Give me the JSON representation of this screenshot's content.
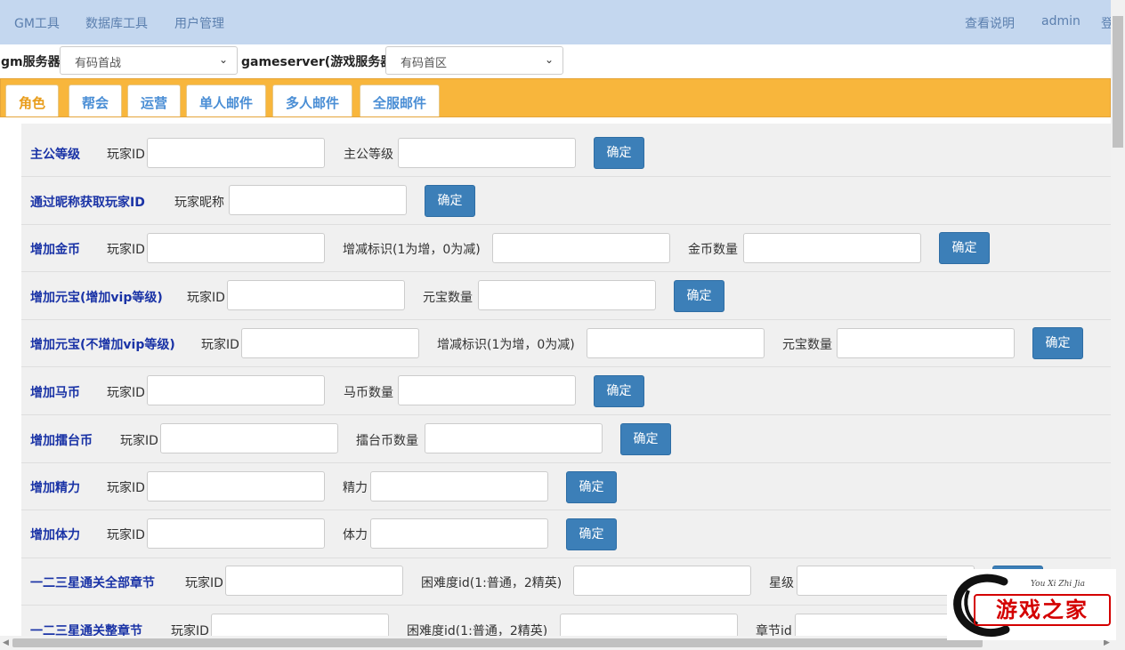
{
  "topnav": {
    "items": [
      "GM工具",
      "数据库工具",
      "用户管理"
    ],
    "right": [
      "查看说明",
      "admin",
      "登"
    ]
  },
  "servers": {
    "gm_label": "gm服务器",
    "gm_value": "有码首战",
    "game_label": "gameserver(游戏服务器)",
    "game_value": "有码首区"
  },
  "tabs": [
    "角色",
    "帮会",
    "运营",
    "单人邮件",
    "多人邮件",
    "全服邮件"
  ],
  "active_tab": "角色",
  "confirm_label": "确定",
  "rows": [
    {
      "title": "主公等级",
      "fields": [
        "玩家ID",
        "主公等级"
      ]
    },
    {
      "title": "通过昵称获取玩家ID",
      "fields": [
        "玩家昵称"
      ]
    },
    {
      "title": "增加金币",
      "fields": [
        "玩家ID",
        "增减标识(1为增，0为减)",
        "金币数量"
      ]
    },
    {
      "title": "增加元宝(增加vip等级)",
      "fields": [
        "玩家ID",
        "元宝数量"
      ]
    },
    {
      "title": "增加元宝(不增加vip等级)",
      "fields": [
        "玩家ID",
        "增减标识(1为增，0为减)",
        "元宝数量"
      ]
    },
    {
      "title": "增加马币",
      "fields": [
        "玩家ID",
        "马币数量"
      ]
    },
    {
      "title": "增加擂台币",
      "fields": [
        "玩家ID",
        "擂台币数量"
      ]
    },
    {
      "title": "增加精力",
      "fields": [
        "玩家ID",
        "精力"
      ]
    },
    {
      "title": "增加体力",
      "fields": [
        "玩家ID",
        "体力"
      ]
    },
    {
      "title": "一二三星通关全部章节",
      "fields": [
        "玩家ID",
        "困难度id(1:普通，2精英)",
        "星级"
      ]
    },
    {
      "title": "一二三星通关整章节",
      "fields": [
        "玩家ID",
        "困难度id(1:普通，2精英)",
        "章节id"
      ]
    }
  ],
  "watermark": {
    "text": "游戏之家",
    "subtitle": "You Xi Zhi Jia"
  },
  "colors": {
    "topnav": "#c4d7ef",
    "tabbar": "#f8b63c",
    "row_title": "#1a33a6",
    "button": "#3c7fb8"
  }
}
